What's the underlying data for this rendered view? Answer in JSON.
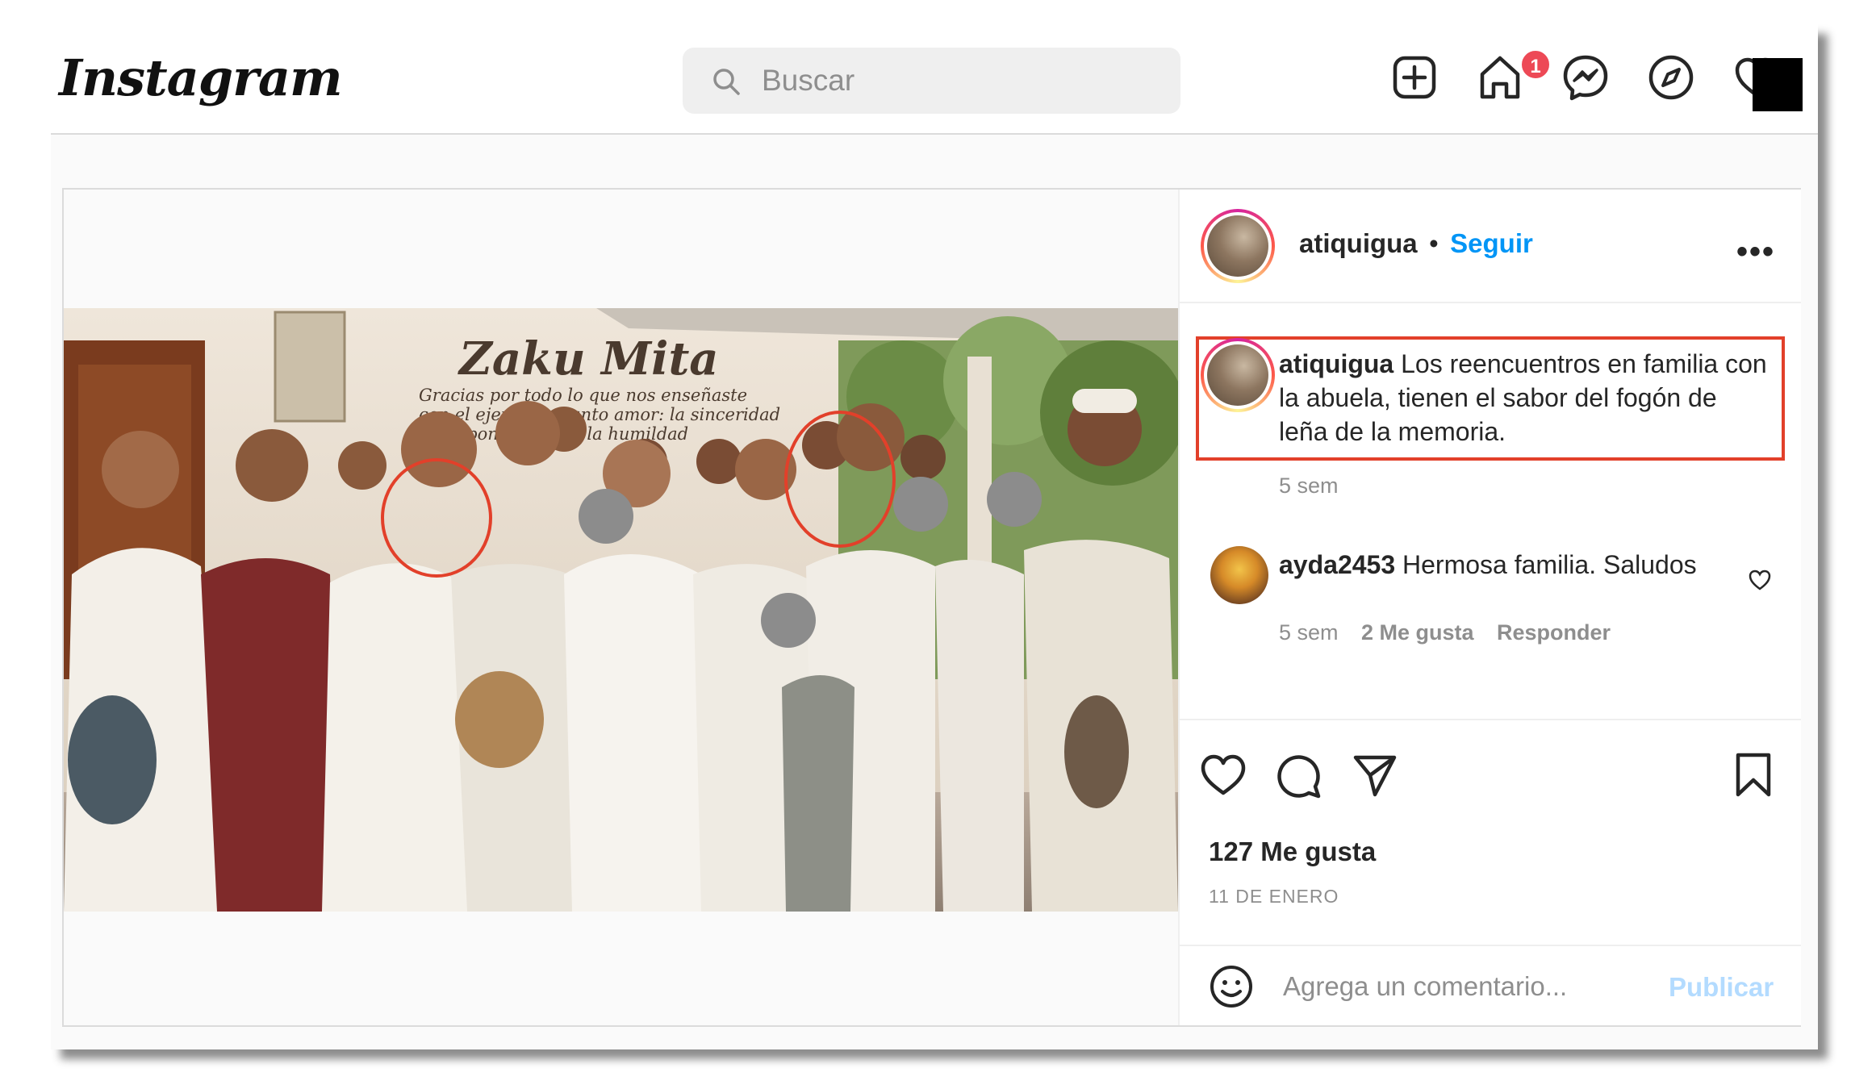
{
  "header": {
    "logo": "Instagram",
    "search_placeholder": "Buscar",
    "messages_badge": "1",
    "icons": [
      "new-post-icon",
      "home-icon",
      "messenger-icon",
      "explore-icon",
      "activity-heart-icon"
    ]
  },
  "post": {
    "author": "atiquigua",
    "separator": "•",
    "follow_label": "Seguir",
    "more_label": "•••",
    "photo_sign_title": "Zaku Mita",
    "photo_sign_text": "Gracias por todo lo que nos enseñaste con el ejemplo y tanto amor: la sinceridad, la responsabilidad, la humildad",
    "caption": {
      "username": "atiquigua",
      "text": " Los reencuentros en familia con la abuela, tienen el sabor del fogón de leña de la memoria.",
      "time": "5 sem"
    },
    "comments": [
      {
        "username": "ayda2453",
        "text": " Hermosa familia. Saludos",
        "time": "5 sem",
        "likes": "2 Me gusta",
        "reply_label": "Responder"
      }
    ],
    "likes": "127 Me gusta",
    "date": "11 DE ENERO",
    "comment_placeholder": "Agrega un comentario...",
    "publish_label": "Publicar"
  },
  "colors": {
    "accent_blue": "#0095f6",
    "highlight_red": "#e2402a",
    "badge_red": "#ed4956"
  }
}
